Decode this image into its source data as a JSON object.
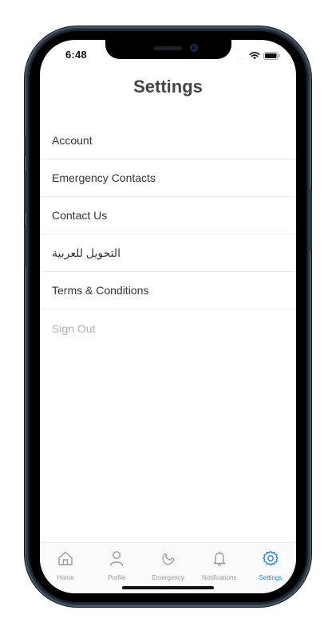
{
  "status_bar": {
    "time": "6:48",
    "signal_dots": "....",
    "icons": [
      "wifi-icon",
      "battery-icon"
    ]
  },
  "header": {
    "title": "Settings"
  },
  "menu": {
    "items": [
      {
        "label": "Account"
      },
      {
        "label": "Emergency Contacts"
      },
      {
        "label": "Contact Us"
      },
      {
        "label": "التحويل للعربية"
      },
      {
        "label": "Terms & Conditions"
      },
      {
        "label": "Sign Out"
      }
    ]
  },
  "tab_bar": {
    "active": "Settings",
    "accent_color": "#1f86d8",
    "inactive_color": "#9a9a9a",
    "tabs": [
      {
        "label": "Home",
        "icon": "home-icon"
      },
      {
        "label": "Profile",
        "icon": "profile-icon"
      },
      {
        "label": "Emergency",
        "icon": "phone-icon"
      },
      {
        "label": "Notifications",
        "icon": "bell-icon"
      },
      {
        "label": "Settings",
        "icon": "gear-icon"
      }
    ]
  }
}
